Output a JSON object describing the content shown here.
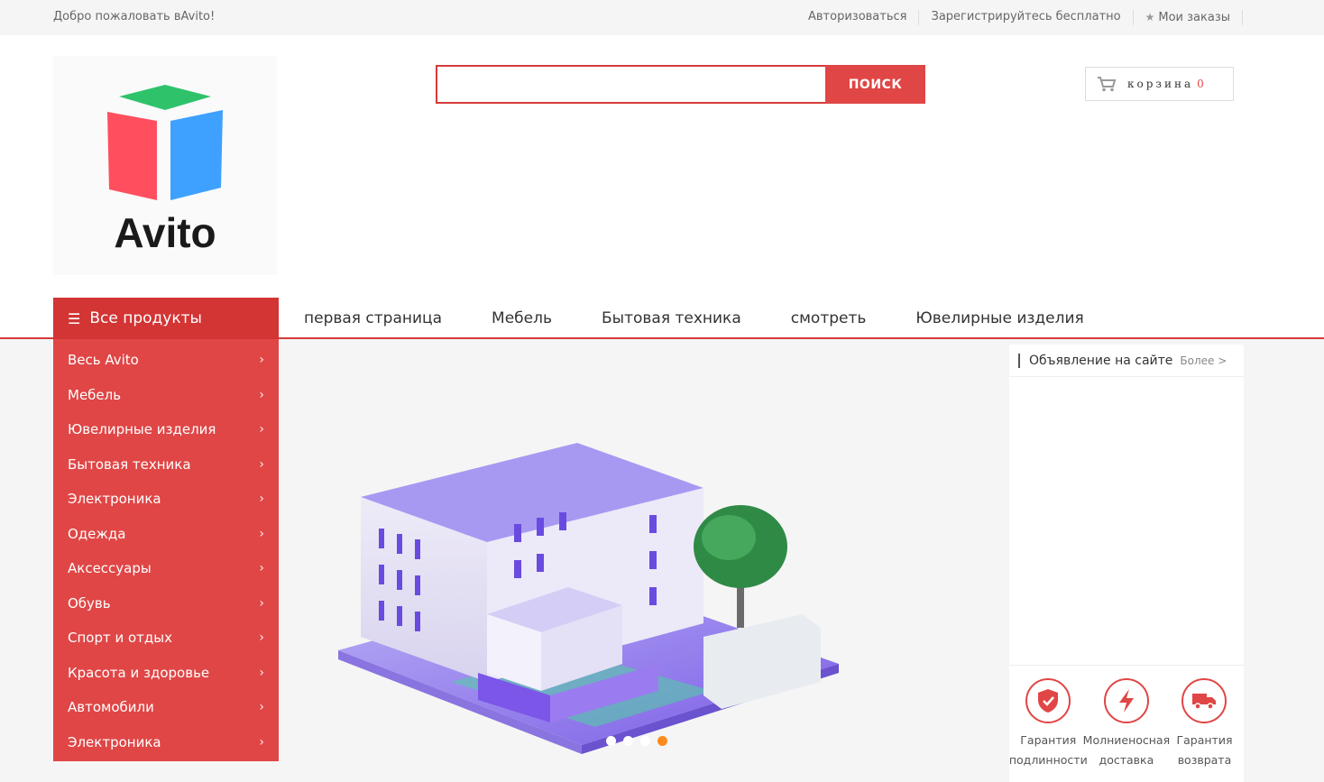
{
  "topbar": {
    "welcome": "Добро пожаловать вAvito!",
    "login": "Авторизоваться",
    "register": "Зарегистрируйтесь бесплатно",
    "orders": "Мои заказы"
  },
  "header": {
    "logo_text": "Avito",
    "search_placeholder": "",
    "search_button": "ПОИСК",
    "cart_label": "корзина",
    "cart_count": "0"
  },
  "nav": {
    "all_products": "Все продукты",
    "links": [
      "первая страница",
      "Мебель",
      "Бытовая техника",
      "смотреть",
      "Ювелирные изделия"
    ]
  },
  "sidebar": {
    "items": [
      "Весь Avito",
      "Мебель",
      "Ювелирные изделия",
      "Бытовая техника",
      "Электроника",
      "Одежда",
      "Аксессуары",
      "Обувь",
      "Спорт и отдых",
      "Красота и здоровье",
      "Автомобили",
      "Электроника"
    ]
  },
  "banner": {
    "slide_count": 4,
    "active_slide": 4
  },
  "notice": {
    "title": "Объявление на сайте",
    "more": "Более >"
  },
  "guarantees": [
    {
      "label": "Гарантия подлинности",
      "icon": "shield-check-icon"
    },
    {
      "label": "Молниеносная доставка",
      "icon": "lightning-icon"
    },
    {
      "label": "Гарантия возврата",
      "icon": "truck-icon"
    }
  ],
  "colors": {
    "brand_red": "#e04646",
    "dark_red": "#d33434",
    "active_dot": "#ff8a1e"
  }
}
